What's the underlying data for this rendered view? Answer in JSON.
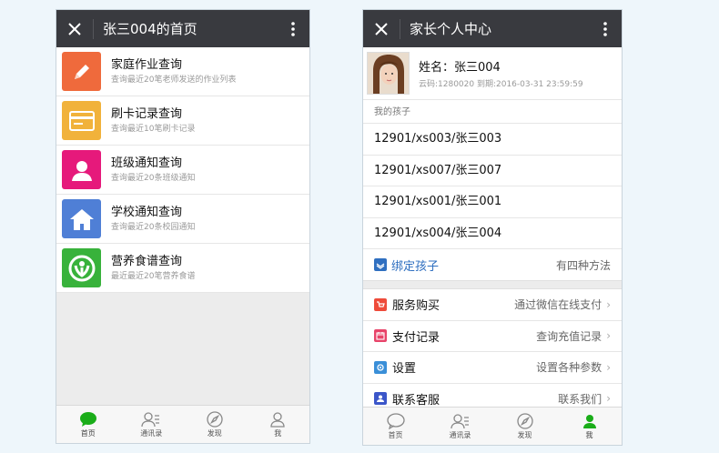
{
  "left": {
    "title": "张三004的首页",
    "menu": [
      {
        "title": "家庭作业查询",
        "desc": "查询最近20笔老师发送的作业列表",
        "color": "#ef6a3c",
        "icon": "pencil-icon"
      },
      {
        "title": "刷卡记录查询",
        "desc": "查询最近10笔刷卡记录",
        "color": "#f1b23b",
        "icon": "card-icon"
      },
      {
        "title": "班级通知查询",
        "desc": "查询最近20条班级通知",
        "color": "#e6197b",
        "icon": "person-icon"
      },
      {
        "title": "学校通知查询",
        "desc": "查询最近20条校园通知",
        "color": "#4f7fd6",
        "icon": "home-icon"
      },
      {
        "title": "营养食谱查询",
        "desc": "最近最近20笔营养食谱",
        "color": "#38b23b",
        "icon": "nutrition-icon"
      }
    ],
    "tabs": [
      {
        "label": "首页",
        "icon": "chat-icon"
      },
      {
        "label": "通讯录",
        "icon": "contacts-icon"
      },
      {
        "label": "发现",
        "icon": "compass-icon"
      },
      {
        "label": "我",
        "icon": "me-icon"
      }
    ]
  },
  "right": {
    "title": "家长个人中心",
    "profile": {
      "name": "姓名：张三004",
      "sub": "云码:1280020 到期:2016-03-31 23:59:59"
    },
    "children_title": "我的孩子",
    "children": [
      "12901/xs003/张三003",
      "12901/xs007/张三007",
      "12901/xs001/张三001",
      "12901/xs004/张三004"
    ],
    "bind": {
      "label": "绑定孩子",
      "right": "有四种方法"
    },
    "options": [
      {
        "label": "服务购买",
        "right": "通过微信在线支付",
        "color": "#ee4b3a",
        "icon": "cart-icon"
      },
      {
        "label": "支付记录",
        "right": "查询充值记录",
        "color": "#e8446a",
        "icon": "calendar-icon"
      },
      {
        "label": "设置",
        "right": "设置各种参数",
        "color": "#3a8fd8",
        "icon": "gear-icon"
      },
      {
        "label": "联系客服",
        "right": "联系我们",
        "color": "#3b56c9",
        "icon": "support-icon"
      }
    ],
    "chevron": "›",
    "tabs": [
      {
        "label": "首页",
        "icon": "chat-icon"
      },
      {
        "label": "通讯录",
        "icon": "contacts-icon"
      },
      {
        "label": "发现",
        "icon": "compass-icon"
      },
      {
        "label": "我",
        "icon": "me-icon"
      }
    ]
  }
}
